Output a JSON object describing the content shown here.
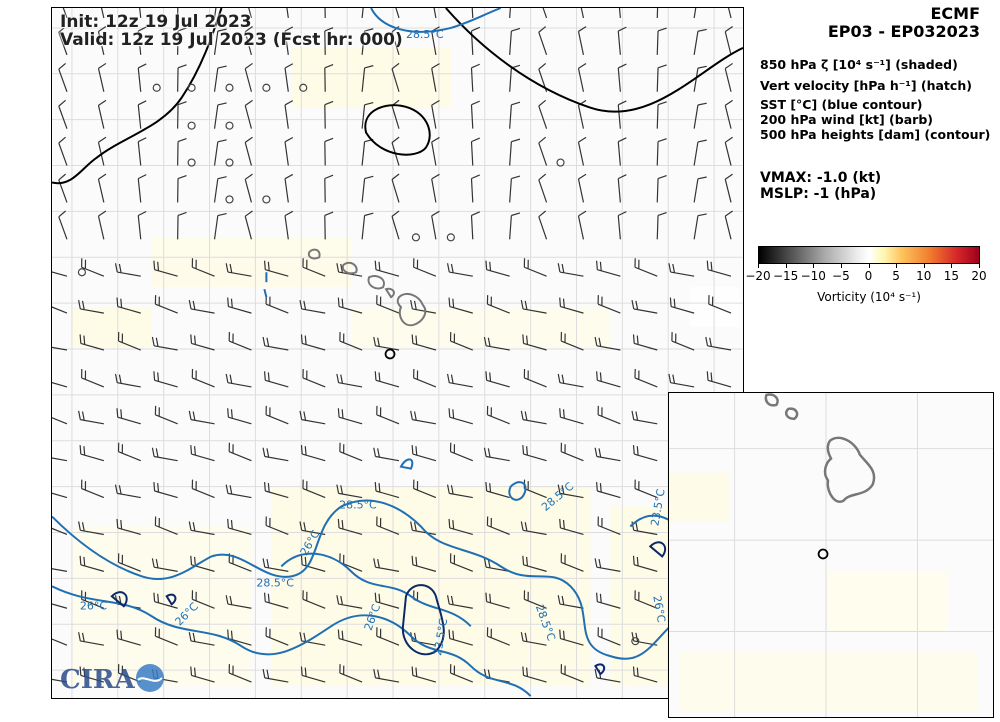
{
  "header": {
    "init_label": "Init:   12z 19 Jul 2023",
    "valid_label": "Valid: 12z 19 Jul 2023 (Fcst hr: 000)"
  },
  "right_panel": {
    "model": "ECMF",
    "storm_ids": "EP03 - EP032023",
    "legend": [
      "850 hPa ζ [10⁴ s⁻¹] (shaded)",
      "Vert velocity [hPa h⁻¹] (hatch)",
      "SST [°C] (blue contour)",
      "200 hPa wind [kt] (barb)",
      "500 hPa heights [dam] (contour)"
    ],
    "vmax_label": "VMAX:  -1.0 (kt)",
    "mslp_label": "MSLP:   -1 (hPa)"
  },
  "colorbar": {
    "ticks": [
      "−20",
      "−15",
      "−10",
      "−5",
      "0",
      "5",
      "10",
      "15",
      "20"
    ],
    "label": "Vorticity (10⁴ s⁻¹)",
    "colors": [
      "#000000",
      "#555555",
      "#aaaaaa",
      "#eeeeee",
      "#ffffff",
      "#fff5b0",
      "#fdc35c",
      "#f07a2e",
      "#d6262a",
      "#a0001c"
    ]
  },
  "map_labels": {
    "sst_labels": [
      "28.5°C",
      "28.5°C",
      "26°C",
      "28.5°C",
      "26°C",
      "26°C",
      "23.5°C",
      "26°C",
      "28.5°C",
      "28.5°C",
      "26°C",
      "23.5°C"
    ]
  },
  "logo": {
    "text": "CIRA"
  },
  "colors": {
    "sst_contour": "#1f6fb5",
    "sst_dark_contour": "#0b2a66",
    "height_contour": "#000000",
    "island_outline": "#777777",
    "barb": "#333333"
  }
}
